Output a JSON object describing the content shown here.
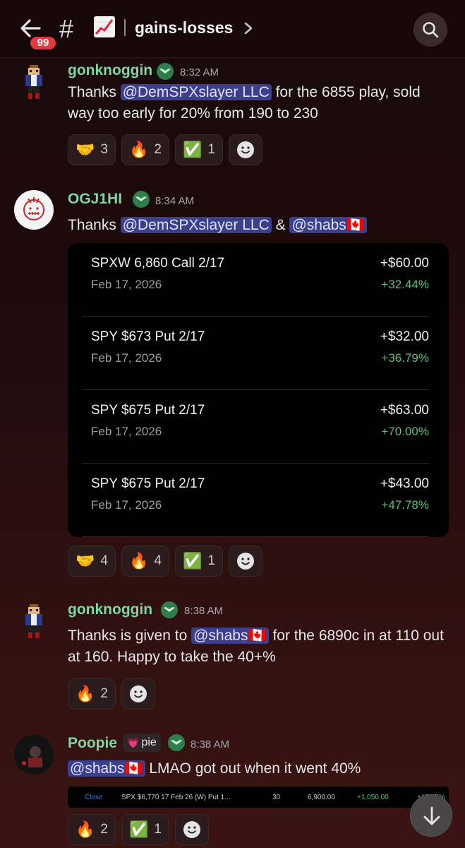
{
  "header": {
    "badge_count": "99",
    "hash": "#",
    "channel_emoji": "📈",
    "channel_name": "gains-losses"
  },
  "messages": [
    {
      "username": "gonknoggin",
      "time": "8:32 AM",
      "text_pre": "Thanks ",
      "mention": "@DemSPXslayer LLC",
      "text_post": " for the 6855 play, sold way too early for 20% from 190 to  230",
      "reactions": [
        {
          "emoji": "🤝",
          "count": "3"
        },
        {
          "emoji": "🔥",
          "count": "2"
        },
        {
          "emoji": "✅",
          "count": "1"
        }
      ]
    },
    {
      "username": "OGJ1HI",
      "time": "8:34 AM",
      "text_pre": "Thanks ",
      "mention": "@DemSPXslayer LLC",
      "text_mid": " & ",
      "mention2": "@shabs🇨🇦",
      "trades": [
        {
          "title": "SPXW 6,860 Call 2/17",
          "date": "Feb 17, 2026",
          "amount": "+$60.00",
          "pct": "+32.44%"
        },
        {
          "title": "SPY $673 Put 2/17",
          "date": "Feb 17, 2026",
          "amount": "+$32.00",
          "pct": "+36.79%"
        },
        {
          "title": "SPY $675 Put 2/17",
          "date": "Feb 17, 2026",
          "amount": "+$63.00",
          "pct": "+70.00%"
        },
        {
          "title": "SPY $675 Put 2/17",
          "date": "Feb 17, 2026",
          "amount": "+$43.00",
          "pct": "+47.78%"
        }
      ],
      "reactions": [
        {
          "emoji": "🤝",
          "count": "4"
        },
        {
          "emoji": "🔥",
          "count": "4"
        },
        {
          "emoji": "✅",
          "count": "1"
        }
      ]
    },
    {
      "username": "gonknoggin",
      "time": "8:38 AM",
      "text_pre": "Thanks is given to ",
      "mention": "@shabs🇨🇦",
      "text_post": " for the 6890c in at 110 out at 160. Happy to take the 40+%",
      "reactions": [
        {
          "emoji": "🔥",
          "count": "2"
        }
      ]
    },
    {
      "username": "Poopie",
      "tag_emoji": "💗",
      "tag_text": "pie",
      "time": "8:38 AM",
      "mention": "@shabs🇨🇦",
      "text_post": " LMAO got out when it went 40%",
      "strip": {
        "status": "Close",
        "desc": "SPX $6,770 17 Feb 26 (W) Put 1...",
        "qty": "30",
        "price": "6,900.00",
        "pnl": "+1,050.00",
        "pct": "+17.95%"
      },
      "reactions": [
        {
          "emoji": "🔥",
          "count": "2"
        },
        {
          "emoji": "✅",
          "count": "1"
        }
      ]
    }
  ],
  "colors": {
    "username": "#7ed6a0",
    "mention_bg": "#3b3f8c",
    "positive": "#5bc07a",
    "badge": "#e5393f"
  }
}
